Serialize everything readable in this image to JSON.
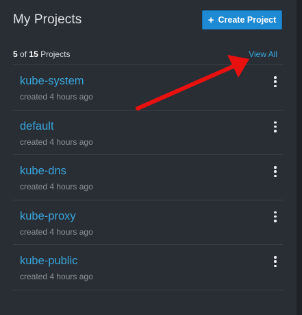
{
  "header": {
    "title": "My Projects",
    "create_button_label": "Create Project"
  },
  "summary": {
    "shown": "5",
    "of_text": "of",
    "total": "15",
    "unit": "Projects",
    "view_all_label": "View All"
  },
  "projects": [
    {
      "name": "kube-system",
      "created": "created 4 hours ago"
    },
    {
      "name": "default",
      "created": "created 4 hours ago"
    },
    {
      "name": "kube-dns",
      "created": "created 4 hours ago"
    },
    {
      "name": "kube-proxy",
      "created": "created 4 hours ago"
    },
    {
      "name": "kube-public",
      "created": "created 4 hours ago"
    }
  ],
  "annotation": {
    "arrow_color": "#e8110f",
    "icon": "red-arrow-icon"
  },
  "colors": {
    "background": "#292e34",
    "link": "#39a5dc",
    "primary_button": "#1f8ad4"
  }
}
